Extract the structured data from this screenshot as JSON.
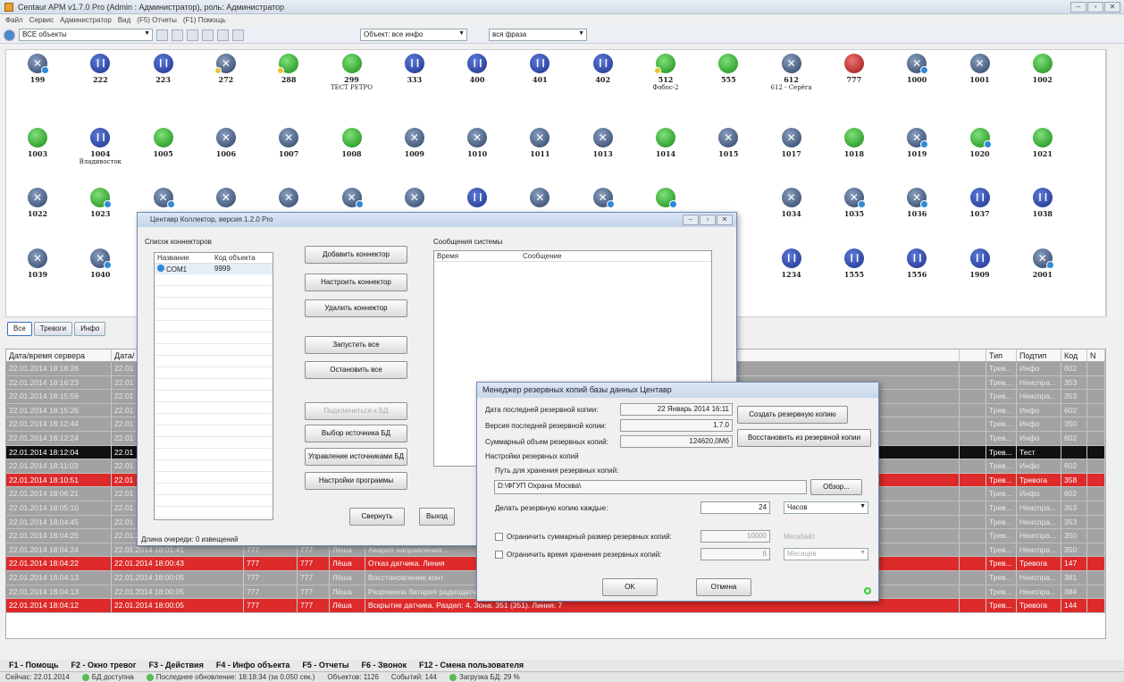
{
  "window": {
    "title": "Centaur APM v1.7.0 Pro (Admin : Администратор), роль: Администратор",
    "buttons": [
      "‒",
      "▫",
      "✕"
    ]
  },
  "menu": [
    "Файл",
    "Сервис",
    "Администратор",
    "Вид",
    "(F5) Отчеты",
    "(F1) Помощь"
  ],
  "toolbar": {
    "objects_combo": "ВСЕ объекты",
    "filter_combo": "Объект: все инфо",
    "phrase_combo": "вся фраза"
  },
  "objects": [
    {
      "label": "199",
      "icon": "x",
      "badge": true
    },
    {
      "label": "222",
      "icon": "pause"
    },
    {
      "label": "223",
      "icon": "pause"
    },
    {
      "label": "272",
      "icon": "x",
      "badgey": true
    },
    {
      "label": "288",
      "icon": "green",
      "badgey": true
    },
    {
      "label": "299",
      "sub": "ТЕСТ РЕТРО",
      "icon": "green"
    },
    {
      "label": "333",
      "icon": "pause"
    },
    {
      "label": "400",
      "icon": "pause"
    },
    {
      "label": "401",
      "icon": "pause"
    },
    {
      "label": "402",
      "icon": "pause"
    },
    {
      "label": "512",
      "sub": "Фобос-2",
      "icon": "green",
      "badgey": true
    },
    {
      "label": "555",
      "icon": "green"
    },
    {
      "label": "612",
      "sub": "612 - Серёга",
      "icon": "x"
    },
    {
      "label": "777",
      "icon": "red"
    },
    {
      "label": "1000",
      "icon": "x",
      "badge": true
    },
    {
      "label": "1001",
      "icon": "x"
    },
    {
      "label": "1002",
      "icon": "green"
    },
    {
      "label": "1003",
      "icon": "green"
    },
    {
      "label": "1004",
      "sub": "Владивосток",
      "icon": "pause"
    },
    {
      "label": "1005",
      "icon": "green"
    },
    {
      "label": "1006",
      "icon": "x"
    },
    {
      "label": "1007",
      "icon": "x"
    },
    {
      "label": "1008",
      "icon": "green"
    },
    {
      "label": "1009",
      "icon": "x"
    },
    {
      "label": "1010",
      "icon": "x"
    },
    {
      "label": "1011",
      "icon": "x"
    },
    {
      "label": "1013",
      "icon": "x"
    },
    {
      "label": "1014",
      "icon": "green"
    },
    {
      "label": "1015",
      "icon": "x"
    },
    {
      "label": "1017",
      "icon": "x"
    },
    {
      "label": "1018",
      "icon": "green"
    },
    {
      "label": "1019",
      "icon": "x",
      "badge": true
    },
    {
      "label": "1020",
      "icon": "green",
      "badge": true
    },
    {
      "label": "1021",
      "icon": "green"
    },
    {
      "label": "1022",
      "icon": "x"
    },
    {
      "label": "1023",
      "icon": "green",
      "badge": true
    },
    {
      "label": "",
      "icon": "x",
      "badge": true
    },
    {
      "label": "",
      "icon": "x"
    },
    {
      "label": "",
      "icon": "x"
    },
    {
      "label": "",
      "icon": "x",
      "badge": true
    },
    {
      "label": "",
      "icon": "x"
    },
    {
      "label": "",
      "icon": "pause"
    },
    {
      "label": "",
      "icon": "x"
    },
    {
      "label": "",
      "icon": "x",
      "badge": true
    },
    {
      "label": "",
      "icon": "green",
      "badge": true
    },
    {
      "label": "",
      "icon": "x",
      "hide": true
    },
    {
      "label": "1034",
      "icon": "x"
    },
    {
      "label": "1035",
      "icon": "x",
      "badge": true
    },
    {
      "label": "1036",
      "icon": "x",
      "badge": true
    },
    {
      "label": "1037",
      "icon": "pause"
    },
    {
      "label": "1038",
      "icon": "pause"
    },
    {
      "label": "1039",
      "icon": "x"
    },
    {
      "label": "1040",
      "icon": "x",
      "badge": true
    },
    {
      "label": "1234",
      "icon": "pause",
      "col": 12
    },
    {
      "label": "1555",
      "icon": "pause",
      "col": 13
    },
    {
      "label": "1556",
      "icon": "pause",
      "col": 14
    },
    {
      "label": "1909",
      "icon": "pause",
      "col": 15
    },
    {
      "label": "2001",
      "icon": "x",
      "badge": true,
      "col": 16
    }
  ],
  "tabs": [
    "Все",
    "Тревоги",
    "Инфо"
  ],
  "log": {
    "headers": [
      "Дата/время сервера",
      "Дата/",
      "",
      "",
      "",
      "",
      "",
      "Тип",
      "Подтип",
      "Код",
      "N"
    ],
    "rows": [
      {
        "cls": "gray",
        "c0": "22.01.2014 18:18:26",
        "c1": "22.01",
        "c2": "",
        "c3": "",
        "c4": "",
        "c5": "",
        "tp": "Трев...",
        "st": "Инфо",
        "kd": "602"
      },
      {
        "cls": "gray",
        "c0": "22.01.2014 18:16:23",
        "c1": "22.01",
        "c2": "",
        "c3": "",
        "c4": "",
        "c5": "",
        "tp": "Трев...",
        "st": "Неиспра...",
        "kd": "353"
      },
      {
        "cls": "gray",
        "c0": "22.01.2014 18:15:59",
        "c1": "22.01",
        "c2": "",
        "c3": "",
        "c4": "",
        "c5": "",
        "tp": "Трев...",
        "st": "Неиспра...",
        "kd": "353"
      },
      {
        "cls": "gray",
        "c0": "22.01.2014 18:15:26",
        "c1": "22.01",
        "c2": "",
        "c3": "",
        "c4": "",
        "c5": "",
        "tp": "Трев...",
        "st": "Инфо",
        "kd": "602"
      },
      {
        "cls": "gray",
        "c0": "22.01.2014 18:12:44",
        "c1": "22.01",
        "c2": "",
        "c3": "",
        "c4": "",
        "c5": "",
        "tp": "Трев...",
        "st": "Инфо",
        "kd": "350"
      },
      {
        "cls": "gray",
        "c0": "22.01.2014 18:12:24",
        "c1": "22.01",
        "c2": "",
        "c3": "",
        "c4": "",
        "c5": "",
        "tp": "Трев...",
        "st": "Инфо",
        "kd": "602"
      },
      {
        "cls": "black",
        "c0": "22.01.2014 18:12:04",
        "c1": "22.01",
        "c2": "",
        "c3": "",
        "c4": "",
        "c5": "",
        "tp": "Трев...",
        "st": "Тест",
        "kd": ""
      },
      {
        "cls": "gray",
        "c0": "22.01.2014 18:11:03",
        "c1": "22.01",
        "c2": "",
        "c3": "",
        "c4": "",
        "c5": "",
        "tp": "Трев...",
        "st": "Инфо",
        "kd": "602"
      },
      {
        "cls": "red",
        "c0": "22.01.2014 18:10:51",
        "c1": "22.01",
        "c2": "",
        "c3": "",
        "c4": "",
        "c5": "",
        "tp": "Трев...",
        "st": "Тревога",
        "kd": "358"
      },
      {
        "cls": "gray",
        "c0": "22.01.2014 18:06:21",
        "c1": "22.01",
        "c2": "",
        "c3": "",
        "c4": "",
        "c5": "",
        "tp": "Трев...",
        "st": "Инфо",
        "kd": "602"
      },
      {
        "cls": "gray",
        "c0": "22.01.2014 18:05:10",
        "c1": "22.01",
        "c2": "",
        "c3": "",
        "c4": "",
        "c5": "",
        "tp": "Трев...",
        "st": "Неиспра...",
        "kd": "353"
      },
      {
        "cls": "gray",
        "c0": "22.01.2014 18:04:45",
        "c1": "22.01",
        "c2": "",
        "c3": "",
        "c4": "",
        "c5": "",
        "tp": "Трев...",
        "st": "Неиспра...",
        "kd": "353"
      },
      {
        "cls": "gray",
        "c0": "22.01.2014 18:04:25",
        "c1": "22.01.2014 18:04:17",
        "c2": "777",
        "c3": "777",
        "c4": "Лёша",
        "c5": "Восстановление напр",
        "tp": "Трев...",
        "st": "Неиспра...",
        "kd": "350"
      },
      {
        "cls": "gray",
        "c0": "22.01.2014 18:04:24",
        "c1": "22.01.2014 18:01:41",
        "c2": "777",
        "c3": "777",
        "c4": "Лёша",
        "c5": "Авария направления ...",
        "tp": "Трев...",
        "st": "Неиспра...",
        "kd": "350"
      },
      {
        "cls": "red",
        "c0": "22.01.2014 18:04:22",
        "c1": "22.01.2014 18:00:43",
        "c2": "777",
        "c3": "777",
        "c4": "Лёша",
        "c5": "Отказ датчика. Линия",
        "tp": "Трев...",
        "st": "Тревога",
        "kd": "147"
      },
      {
        "cls": "gray",
        "c0": "22.01.2014 18:04:13",
        "c1": "22.01.2014 18:00:05",
        "c2": "777",
        "c3": "777",
        "c4": "Лёша",
        "c5": "Восстановление конт",
        "tp": "Трев...",
        "st": "Неиспра...",
        "kd": "381"
      },
      {
        "cls": "gray",
        "c0": "22.01.2014 18:04:13",
        "c1": "22.01.2014 18:00:05",
        "c2": "777",
        "c3": "777",
        "c4": "Лёша",
        "c5": "Разряжена батарея радиодатчика. Раздел: 4. Зона: 351 (351). Линия: 7",
        "tp": "Трев...",
        "st": "Неиспра...",
        "kd": "384"
      },
      {
        "cls": "red",
        "c0": "22.01.2014 18:04:12",
        "c1": "22.01.2014 18:00:05",
        "c2": "777",
        "c3": "777",
        "c4": "Лёша",
        "c5": "Вскрытие датчика. Раздел: 4. Зона: 351 (351). Линия: 7",
        "tp": "Трев...",
        "st": "Тревога",
        "kd": "144"
      }
    ]
  },
  "fkeys": [
    "F1 - Помощь",
    "F2 - Окно тревог",
    "F3 - Действия",
    "F4 - Инфо объекта",
    "F5 - Отчеты",
    "F6 - Звонок",
    "F12 - Смена пользователя"
  ],
  "status": {
    "today": "Сейчас: 22.01.2014",
    "db": "БД доступна",
    "update": "Последнее обновление: 18:18:34 (за 0.050 сек.)",
    "objects": "Объектов: 1126",
    "events": "Событий: 144",
    "load": "Загрузка БД: 29 %"
  },
  "collector": {
    "title": "Центавр Коллектор, версия 1.2.0 Pro",
    "list_label": "Список коннекторов",
    "col_name": "Название",
    "col_code": "Код объекта",
    "row_name": "COM1",
    "row_code": "9999",
    "messages_label": "Сообщения системы",
    "msg_col_time": "Время",
    "msg_col_msg": "Сообщение",
    "btn_add": "Добавить коннектор",
    "btn_config": "Настроить коннектор",
    "btn_delete": "Удалить коннектор",
    "btn_start": "Запустить все",
    "btn_stop": "Остановить все",
    "btn_connect": "Подключиться к БД",
    "btn_source": "Выбор источника БД",
    "btn_manage": "Управление источниками БД",
    "btn_settings": "Настройки программы",
    "btn_collapse": "Свернуть",
    "btn_exit": "Выход",
    "queue": "Длина очереди: 0 извещений"
  },
  "backup": {
    "title": "Менеджер резервных копий базы данных Центавр",
    "last_date_label": "Дата последней резервной копии:",
    "last_date": "22 Январь 2014 16:11",
    "version_label": "Версия последней резервной копии:",
    "version": "1.7.0",
    "size_label": "Суммарный объем резервных копий:",
    "size": "124620,0Мб",
    "btn_create": "Создать резервную копию",
    "btn_restore": "Восстановить из резервной копии",
    "settings_label": "Настройки резервных копий",
    "path_label": "Путь для хранения резервных копий:",
    "path": "D:\\ФГУП Охрана Москва\\",
    "btn_browse": "Обзор...",
    "every_label": "Делать резервную копию каждые:",
    "every_value": "24",
    "every_unit": "Часов",
    "limit_size_label": "Ограничить суммарный размер резервных копий:",
    "limit_size": "10000",
    "limit_size_unit": "Мегабайт",
    "limit_time_label": "Ограничить время хранения резервных копий:",
    "limit_time": "6",
    "limit_time_unit": "Месяцев",
    "btn_ok": "OK",
    "btn_cancel": "Отмена"
  }
}
